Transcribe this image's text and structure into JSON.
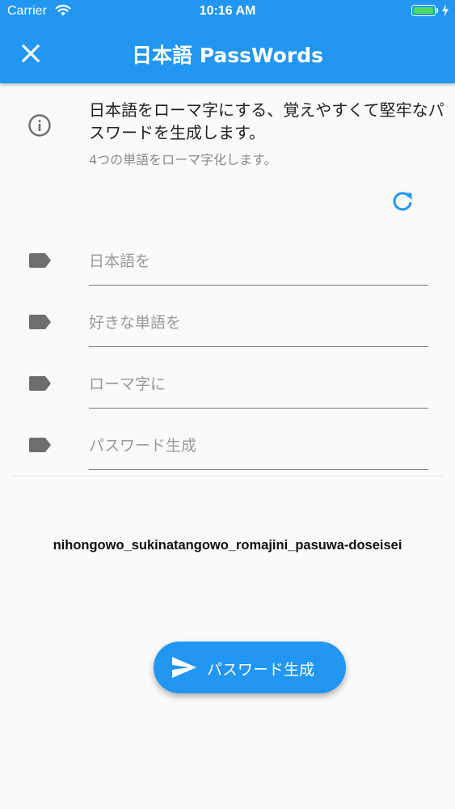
{
  "status_bar": {
    "carrier": "Carrier",
    "time": "10:16 AM"
  },
  "app_bar": {
    "title": "日本語 PassWords"
  },
  "description": {
    "main": "日本語をローマ字にする、覚えやすくて堅牢なパスワードを生成します。",
    "sub": "4つの単語をローマ字化します。"
  },
  "fields": [
    {
      "placeholder": "日本語を"
    },
    {
      "placeholder": "好きな単語を"
    },
    {
      "placeholder": "ローマ字に"
    },
    {
      "placeholder": "パスワード生成"
    }
  ],
  "result": "nihongowo_sukinatangowo_romajini_pasuwa-doseisei",
  "fab": {
    "label": "パスワード生成"
  },
  "colors": {
    "primary": "#2196f3",
    "background": "#fafafa",
    "battery": "#4cd964"
  },
  "icons": [
    "close-icon",
    "info-icon",
    "refresh-icon",
    "label-tag-icon",
    "send-icon",
    "wifi-icon",
    "battery-icon"
  ]
}
